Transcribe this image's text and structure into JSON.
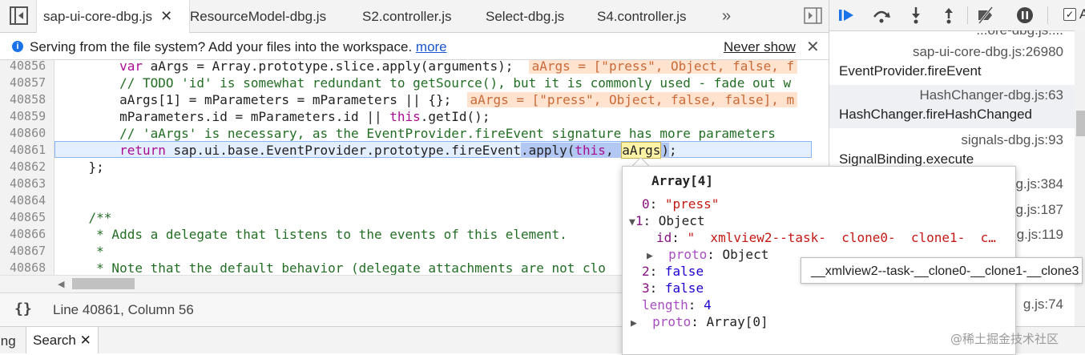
{
  "tabs": [
    {
      "label": "sap-ui-core-dbg.js",
      "active": true,
      "closable": true
    },
    {
      "label": "ResourceModel-dbg.js"
    },
    {
      "label": "S2.controller.js"
    },
    {
      "label": "Select-dbg.js"
    },
    {
      "label": "S4.controller.js"
    }
  ],
  "tabs_overflow": "»",
  "infobar": {
    "message": "Serving from the file system? Add your files into the workspace.",
    "more_link": "more",
    "never_show": "Never show",
    "close": "✕"
  },
  "code_lines": [
    {
      "n": "40856",
      "code": "        var aArgs = Array.prototype.slice.apply(arguments);",
      "inline": "aArgs = [\"press\", Object, false, f"
    },
    {
      "n": "40857",
      "code": "        // TODO 'id' is somewhat redundant to getSource(), but it is commonly used - fade out w"
    },
    {
      "n": "40858",
      "code": "        aArgs[1] = mParameters = mParameters || {};",
      "inline": "aArgs = [\"press\", Object, false, false], m"
    },
    {
      "n": "40859",
      "code": "        mParameters.id = mParameters.id || this.getId();"
    },
    {
      "n": "40860",
      "code": "        // 'aArgs' is necessary, as the EventProvider.fireEvent signature has more parameters"
    },
    {
      "n": "40861",
      "code": "        return sap.ui.base.EventProvider.prototype.fireEvent.apply(this, aArgs);"
    },
    {
      "n": "40862",
      "code": "    };"
    },
    {
      "n": "40863",
      "code": ""
    },
    {
      "n": "40864",
      "code": ""
    },
    {
      "n": "40865",
      "code": "    /**"
    },
    {
      "n": "40866",
      "code": "     * Adds a delegate that listens to the events of this element."
    },
    {
      "n": "40867",
      "code": "     *"
    },
    {
      "n": "40868",
      "code": "     * Note that the default behavior (delegate attachments are not clo"
    },
    {
      "n": "40869",
      "code": ""
    }
  ],
  "status": {
    "braces": "{}",
    "cursor": "Line 40861, Column 56"
  },
  "drawer": {
    "prev_tab": "ing",
    "search_tab": "Search",
    "close": "✕"
  },
  "debugger": {
    "checkbox_label": "A",
    "top_partial": "...ore-dbg.js:...",
    "frames": [
      {
        "loc": "sap-ui-core-dbg.js:26980",
        "fn": "EventProvider.fireEvent"
      },
      {
        "loc": "HashChanger-dbg.js:63",
        "fn": "HashChanger.fireHashChanged",
        "selected": true
      },
      {
        "loc": "signals-dbg.js:93",
        "fn": "SignalBinding.execute"
      }
    ],
    "partial_locs": [
      "g.js:384",
      "g.js:187",
      "g.js:119",
      "g.js:74"
    ]
  },
  "popover": {
    "title": "Array[4]",
    "items": [
      {
        "key": "0",
        "value": "\"press\"",
        "type": "string"
      },
      {
        "key": "1",
        "value": "Object",
        "type": "object",
        "expanded": true
      },
      {
        "key": "id",
        "value": "\"  xmlview2--task-  clone0-  clone1-  c…",
        "type": "string"
      },
      {
        "key": "proto",
        "value": "Object",
        "type": "proto"
      },
      {
        "key": "2",
        "value": "false",
        "type": "bool"
      },
      {
        "key": "3",
        "value": "false",
        "type": "bool"
      },
      {
        "key": "length",
        "value": "4",
        "type": "number"
      },
      {
        "key": "proto",
        "value": "Array[0]",
        "type": "proto"
      }
    ]
  },
  "tooltip": "__xmlview2--task-__clone0-__clone1-__clone3",
  "watermark": "@稀土掘金技术社区"
}
